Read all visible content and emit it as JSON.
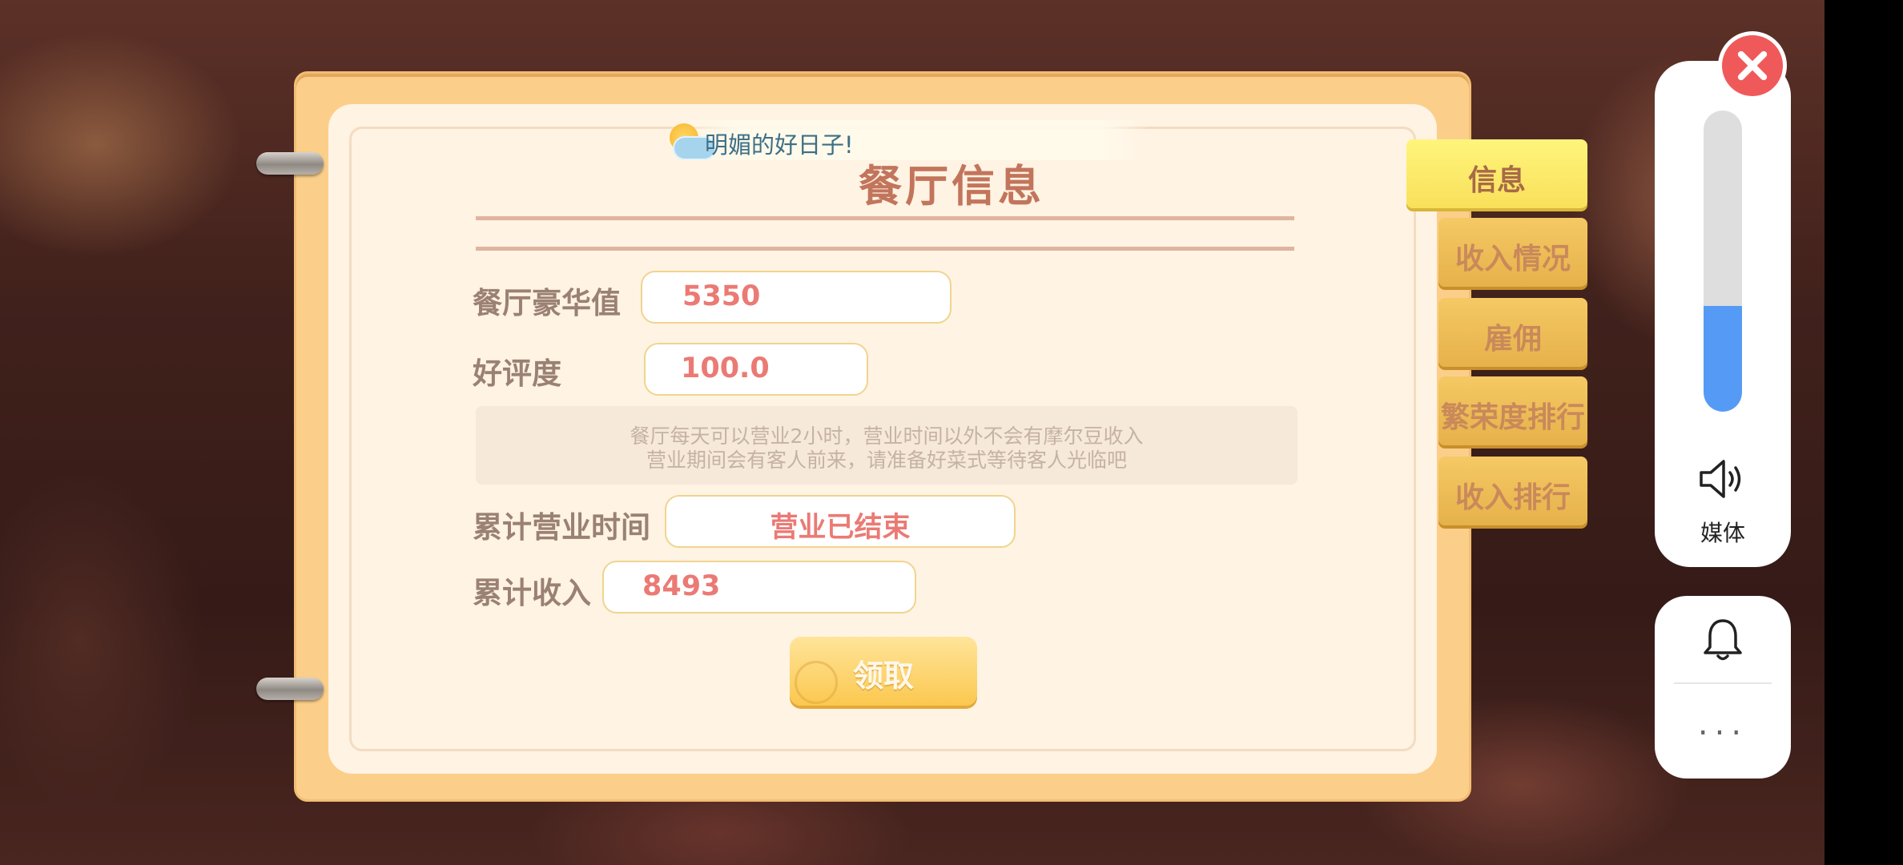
{
  "banner": {
    "text": "明媚的好日子!"
  },
  "panel": {
    "title": "餐厅信息",
    "luxury": {
      "label": "餐厅豪华值",
      "value": "5350"
    },
    "rating": {
      "label": "好评度",
      "value": "100.0"
    },
    "notice": {
      "line1": "餐厅每天可以营业2小时，营业时间以外不会有摩尔豆收入",
      "line2": "营业期间会有客人前来，请准备好菜式等待客人光临吧"
    },
    "hours": {
      "label": "累计营业时间",
      "value": "营业已结束"
    },
    "income": {
      "label": "累计收入",
      "value": "8493"
    },
    "claim_label": "领取"
  },
  "tabs": [
    {
      "label": "信息",
      "active": true
    },
    {
      "label": "收入情况",
      "active": false
    },
    {
      "label": "雇佣",
      "active": false
    },
    {
      "label": "繁荣度排行",
      "active": false
    },
    {
      "label": "收入排行",
      "active": false
    }
  ],
  "system": {
    "volume_level": 0.35,
    "media_label": "媒体",
    "more_label": "...",
    "accent_color": "#559bf6",
    "close_color": "#f0595a"
  }
}
